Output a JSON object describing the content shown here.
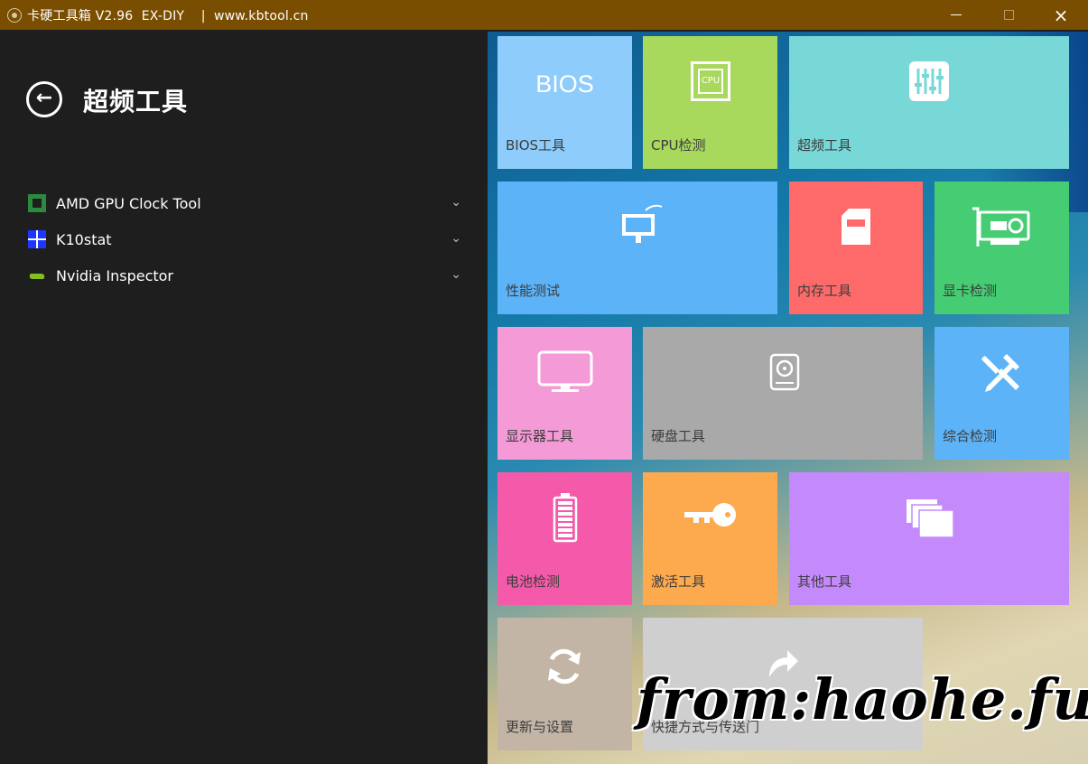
{
  "window": {
    "title": "卡硬工具箱 V2.96  EX-DIY    |  www.kbtool.cn",
    "minimize_label": "",
    "close_label": "×"
  },
  "sidebar": {
    "back_label": "←",
    "title": "超频工具",
    "items": [
      {
        "label": "AMD GPU Clock Tool",
        "icon": "amd-icon"
      },
      {
        "label": "K10stat",
        "icon": "k10stat-icon"
      },
      {
        "label": "Nvidia Inspector",
        "icon": "nvidia-icon"
      }
    ],
    "chevron": "⌄"
  },
  "tiles": [
    {
      "label": "BIOS工具",
      "icon": "bios-icon",
      "icon_text": "BIOS",
      "color": "#8ecdfb"
    },
    {
      "label": "CPU检测",
      "icon": "cpu-icon",
      "icon_text": "CPU",
      "color": "#a8d85c"
    },
    {
      "label": "超频工具",
      "icon": "sliders-icon",
      "color": "#78d7d7"
    },
    {
      "label": "性能测试",
      "icon": "monitor-icon",
      "color": "#5cb3f7"
    },
    {
      "label": "内存工具",
      "icon": "sdcard-icon",
      "color": "#fe6a6a"
    },
    {
      "label": "显卡检测",
      "icon": "gpu-card-icon",
      "color": "#46cc72"
    },
    {
      "label": "显示器工具",
      "icon": "display-icon",
      "color": "#f49ad7"
    },
    {
      "label": "硬盘工具",
      "icon": "harddisk-icon",
      "color": "#a9a9a9"
    },
    {
      "label": "综合检测",
      "icon": "wrench-icon",
      "color": "#5cb3f7"
    },
    {
      "label": "电池检测",
      "icon": "battery-icon",
      "color": "#f45aa9"
    },
    {
      "label": "激活工具",
      "icon": "key-icon",
      "color": "#fdaa4e"
    },
    {
      "label": "其他工具",
      "icon": "windows-stack-icon",
      "color": "#c48afc"
    },
    {
      "label": "更新与设置",
      "icon": "refresh-icon",
      "color": "#c3b5a6"
    },
    {
      "label": "快捷方式与传送门",
      "icon": "share-arrow-icon",
      "color": "#cfcfcf"
    }
  ],
  "watermark": "from:haohe.fun"
}
